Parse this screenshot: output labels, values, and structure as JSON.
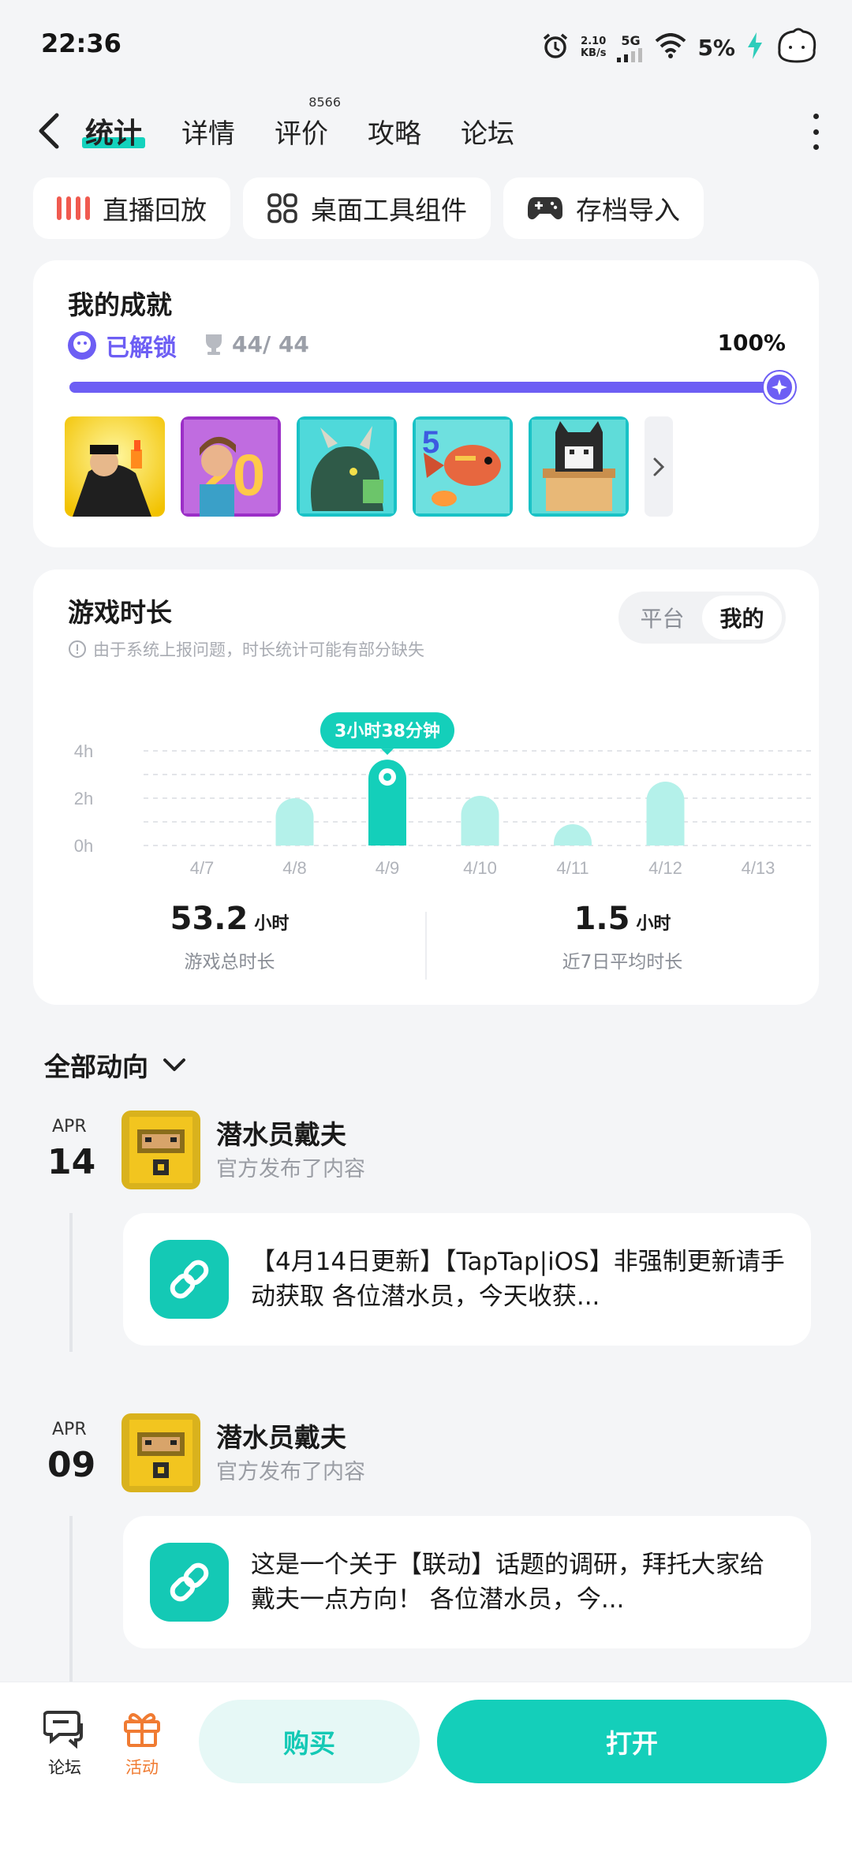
{
  "status_bar": {
    "time": "22:36",
    "net_speed_value": "2.10",
    "net_speed_unit": "KB/s",
    "network": "5G",
    "battery": "5%"
  },
  "nav": {
    "tabs": [
      {
        "label": "统计",
        "active": true
      },
      {
        "label": "详情"
      },
      {
        "label": "评价",
        "badge": "8566"
      },
      {
        "label": "攻略"
      },
      {
        "label": "论坛"
      }
    ]
  },
  "chips": [
    {
      "label": "直播回放",
      "icon": "live-bars-icon"
    },
    {
      "label": "桌面工具组件",
      "icon": "widget-grid-icon"
    },
    {
      "label": "存档导入",
      "icon": "gamepad-icon"
    }
  ],
  "achievements": {
    "title": "我的成就",
    "unlocked_label": "已解锁",
    "count": "44/ 44",
    "percent_text": "100%",
    "progress": 1.0,
    "accent": "#6d5ef4"
  },
  "playtime": {
    "title": "游戏时长",
    "note": "由于系统上报问题，时长统计可能有部分缺失",
    "toggle": [
      "平台",
      "我的"
    ],
    "toggle_selected": 1,
    "total_value": "53.2",
    "total_unit": "小时",
    "total_label": "游戏总时长",
    "avg_value": "1.5",
    "avg_unit": "小时",
    "avg_label": "近7日平均时长",
    "accent": "#14cfba"
  },
  "chart_data": {
    "type": "bar",
    "categories": [
      "4/7",
      "4/8",
      "4/9",
      "4/10",
      "4/11",
      "4/12",
      "4/13"
    ],
    "values": [
      0,
      2.0,
      3.63,
      2.1,
      0.2,
      2.7,
      0
    ],
    "y_ticks": [
      "0h",
      "2h",
      "4h"
    ],
    "ylim": [
      0,
      4
    ],
    "highlight_index": 2,
    "highlight_label": "3小时38分钟",
    "grid": true
  },
  "feed": {
    "header": "全部动向",
    "posts": [
      {
        "month": "APR",
        "day": "14",
        "author": "潜水员戴夫",
        "action": "官方发布了内容",
        "text": "【4月14日更新】【TapTap|iOS】非强制更新请手动获取 各位潜水员，今天收获..."
      },
      {
        "month": "APR",
        "day": "09",
        "author": "潜水员戴夫",
        "action": "官方发布了内容",
        "text": "这是一个关于【联动】话题的调研，拜托大家给戴夫一点方向！ 各位潜水员，今..."
      }
    ]
  },
  "bottom_bar": {
    "forum_label": "论坛",
    "activity_label": "活动",
    "buy_label": "购买",
    "open_label": "打开"
  }
}
